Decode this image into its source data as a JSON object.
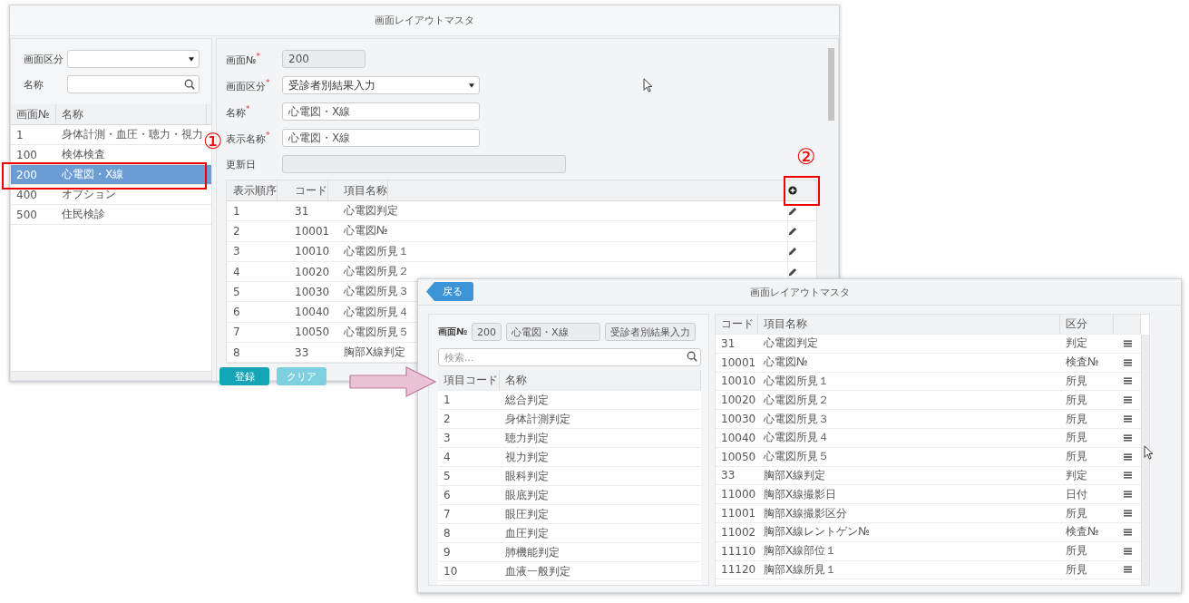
{
  "main_window": {
    "title": "画面レイアウトマスタ",
    "filters": [
      {
        "label": "画面区分",
        "kind": "select"
      },
      {
        "label": "名称",
        "kind": "search"
      }
    ],
    "list": {
      "columns": [
        "画面№",
        "名称"
      ],
      "rows": [
        {
          "cells": [
            "1",
            "身体計測・血圧・聴力・視力"
          ],
          "selected": false
        },
        {
          "cells": [
            "100",
            "検体検査"
          ],
          "selected": false
        },
        {
          "cells": [
            "200",
            "心電図・X線"
          ],
          "selected": true
        },
        {
          "cells": [
            "400",
            "オプション"
          ],
          "selected": false
        },
        {
          "cells": [
            "500",
            "住民検診"
          ],
          "selected": false
        }
      ]
    },
    "form": [
      {
        "label": "画面№$^{*}$",
        "kind": "readonly",
        "value": "200"
      },
      {
        "label": "画面区分$^{*}$",
        "kind": "select",
        "value": "受診者別結果入力"
      },
      {
        "label": "名称$^{*}$",
        "kind": "text",
        "value": "心電図・X線"
      },
      {
        "label": "表示名称$^{*}$",
        "kind": "text",
        "value": "心電図・X線"
      },
      {
        "label": "更新日",
        "kind": "readonly"
      }
    ],
    "items": {
      "columns": [
        "表示順序",
        "コード",
        "項目名称"
      ],
      "rows": [
        {
          "cells": [
            "1",
            "31",
            "心電図判定"
          ],
          "edit_icon": true
        },
        {
          "cells": [
            "2",
            "10001",
            "心電図№"
          ],
          "edit_icon": true
        },
        {
          "cells": [
            "3",
            "10010",
            "心電図所見１"
          ],
          "edit_icon": true
        },
        {
          "cells": [
            "4",
            "10020",
            "心電図所見２"
          ],
          "edit_icon": true
        },
        {
          "cells": [
            "5",
            "10030",
            "心電図所見３"
          ],
          "edit_icon": false
        },
        {
          "cells": [
            "6",
            "10040",
            "心電図所見４"
          ],
          "edit_icon": false
        },
        {
          "cells": [
            "7",
            "10050",
            "心電図所見５"
          ],
          "edit_icon": false
        },
        {
          "cells": [
            "8",
            "33",
            "胸部X線判定"
          ],
          "edit_icon": false
        }
      ]
    },
    "buttons": [
      {
        "label": "登録",
        "kind": "primary"
      },
      {
        "label": "クリア",
        "kind": "secondary"
      }
    ]
  },
  "sub_window": {
    "back_button": "戻る",
    "title": "画面レイアウトマスタ",
    "screen_no_label": "画面№",
    "screen_fields": [
      "200",
      "心電図・X線",
      "受診者別結果入力"
    ],
    "search": {
      "placeholder": "検索..."
    },
    "catalog": {
      "columns": [
        "項目コード",
        "名称"
      ],
      "rows": [
        [
          "1",
          "総合判定"
        ],
        [
          "2",
          "身体計測判定"
        ],
        [
          "3",
          "聴力判定"
        ],
        [
          "4",
          "視力判定"
        ],
        [
          "5",
          "眼科判定"
        ],
        [
          "6",
          "眼底判定"
        ],
        [
          "7",
          "眼圧判定"
        ],
        [
          "8",
          "血圧判定"
        ],
        [
          "9",
          "肺機能判定"
        ],
        [
          "10",
          "血液一般判定"
        ]
      ]
    },
    "layout": {
      "columns": [
        "コード",
        "項目名称",
        "区分"
      ],
      "rows": [
        [
          "31",
          "心電図判定",
          "判定"
        ],
        [
          "10001",
          "心電図№",
          "検査№"
        ],
        [
          "10010",
          "心電図所見１",
          "所見"
        ],
        [
          "10020",
          "心電図所見２",
          "所見"
        ],
        [
          "10030",
          "心電図所見３",
          "所見"
        ],
        [
          "10040",
          "心電図所見４",
          "所見"
        ],
        [
          "10050",
          "心電図所見５",
          "所見"
        ],
        [
          "33",
          "胸部X線判定",
          "判定"
        ],
        [
          "11000",
          "胸部X線撮影日",
          "日付"
        ],
        [
          "11001",
          "胸部X線撮影区分",
          "所見"
        ],
        [
          "11002",
          "胸部X線レントゲン№",
          "検査№"
        ],
        [
          "11110",
          "胸部X線部位１",
          "所見"
        ],
        [
          "11120",
          "胸部X線所見１",
          "所見"
        ]
      ]
    }
  },
  "annotations": [
    {
      "label": "①"
    },
    {
      "label": "②"
    }
  ]
}
